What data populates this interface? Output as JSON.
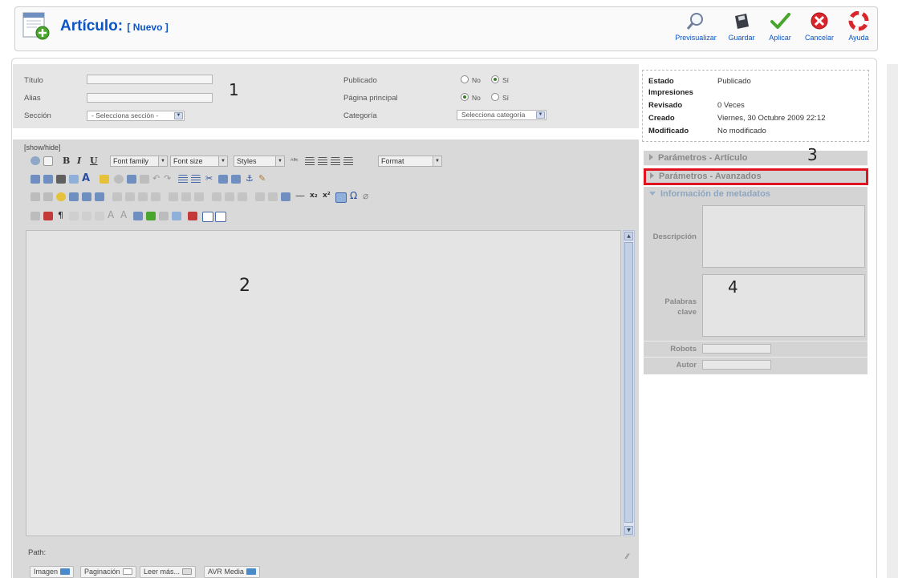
{
  "header": {
    "title": "Artículo:",
    "subtitle": "[ Nuevo ]",
    "toolbar": {
      "preview": "Previsualizar",
      "save": "Guardar",
      "apply": "Aplicar",
      "cancel": "Cancelar",
      "help": "Ayuda"
    }
  },
  "form": {
    "title_label": "Título",
    "alias_label": "Alias",
    "section_label": "Sección",
    "section_value": "- Selecciona sección -",
    "published_label": "Publicado",
    "frontpage_label": "Página principal",
    "category_label": "Categoría",
    "category_value": "Selecciona categoría",
    "no": "No",
    "yes": "Sí"
  },
  "editor": {
    "show_hide": "[show/hide]",
    "font_family": "Font family",
    "font_size": "Font size",
    "styles": "Styles",
    "format": "Format",
    "path_label": "Path:",
    "buttons": {
      "image": "Imagen",
      "pagination": "Paginación",
      "read_more": "Leer más...",
      "avr_media": "AVR Media"
    }
  },
  "info": {
    "status_label": "Estado",
    "status_value": "Publicado",
    "hits_label": "Impresiones",
    "revised_label": "Revisado",
    "revised_value": "0 Veces",
    "created_label": "Creado",
    "created_value": "Viernes, 30 Octubre 2009 22:12",
    "modified_label": "Modificado",
    "modified_value": "No modificado"
  },
  "panels": {
    "article_params": "Parámetros - Artículo",
    "advanced_params": "Parámetros - Avanzados",
    "metadata_info": "Información de metadatos",
    "description_label": "Descripción",
    "keywords_label": "Palabras clave",
    "robots_label": "Robots",
    "author_label": "Autor"
  },
  "annotations": {
    "a1": "1",
    "a2": "2",
    "a3": "3",
    "a4": "4"
  },
  "colors": {
    "title_blue": "#0B55C4",
    "highlight_red": "#E0141E",
    "accept_green": "#4AA52E",
    "cancel_red": "#D9262C"
  }
}
